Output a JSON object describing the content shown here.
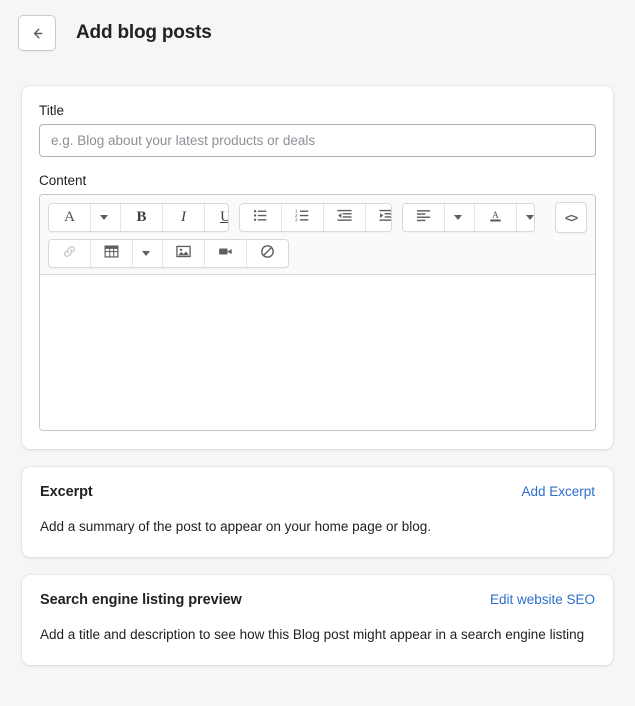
{
  "header": {
    "back_icon": "arrow-left-icon",
    "title": "Add blog posts"
  },
  "main_card": {
    "title_label": "Title",
    "title_value": "",
    "title_placeholder": "e.g. Blog about your latest products or deals",
    "content_label": "Content",
    "content_value": ""
  },
  "editor_toolbar": {
    "row1": [
      {
        "name": "font-style-button",
        "glyph": "A",
        "type": "text-serif"
      },
      {
        "name": "font-style-dropdown-caret",
        "glyph": "",
        "type": "caret"
      },
      {
        "name": "bold-button",
        "glyph": "B",
        "type": "text-bold"
      },
      {
        "name": "italic-button",
        "glyph": "I",
        "type": "text-italic"
      },
      {
        "name": "underline-button",
        "glyph": "U",
        "type": "text-underline"
      },
      {
        "name": "bulleted-list-button",
        "glyph": "",
        "type": "icon"
      },
      {
        "name": "numbered-list-button",
        "glyph": "",
        "type": "icon"
      },
      {
        "name": "outdent-button",
        "glyph": "",
        "type": "icon"
      },
      {
        "name": "indent-button",
        "glyph": "",
        "type": "icon"
      },
      {
        "name": "align-left-button",
        "glyph": "",
        "type": "icon"
      },
      {
        "name": "align-dropdown-caret",
        "glyph": "",
        "type": "caret"
      },
      {
        "name": "text-color-button",
        "glyph": "A",
        "type": "icon"
      },
      {
        "name": "text-color-dropdown-caret",
        "glyph": "",
        "type": "caret"
      },
      {
        "name": "code-view-button",
        "glyph": "<>",
        "type": "text-code"
      }
    ],
    "row2": [
      {
        "name": "insert-link-button",
        "glyph": "",
        "type": "icon"
      },
      {
        "name": "insert-table-button",
        "glyph": "",
        "type": "icon"
      },
      {
        "name": "table-dropdown-caret",
        "glyph": "",
        "type": "caret"
      },
      {
        "name": "insert-image-button",
        "glyph": "",
        "type": "icon"
      },
      {
        "name": "insert-video-button",
        "glyph": "",
        "type": "icon"
      },
      {
        "name": "clear-formatting-button",
        "glyph": "",
        "type": "icon"
      }
    ]
  },
  "excerpt": {
    "title": "Excerpt",
    "action_label": "Add Excerpt",
    "description": "Add a summary of the post to appear on your home page or blog."
  },
  "seo": {
    "title": "Search engine listing preview",
    "action_label": "Edit website SEO",
    "description": "Add a title and description to see how this Blog post might appear in a search engine listing"
  },
  "colors": {
    "page_background": "#f6f6f7",
    "card_background": "#ffffff",
    "link": "#2c6ecb",
    "text": "#202223",
    "placeholder": "#8c9196",
    "toolbar_background": "#fafafa",
    "border": "#c9cccf"
  }
}
